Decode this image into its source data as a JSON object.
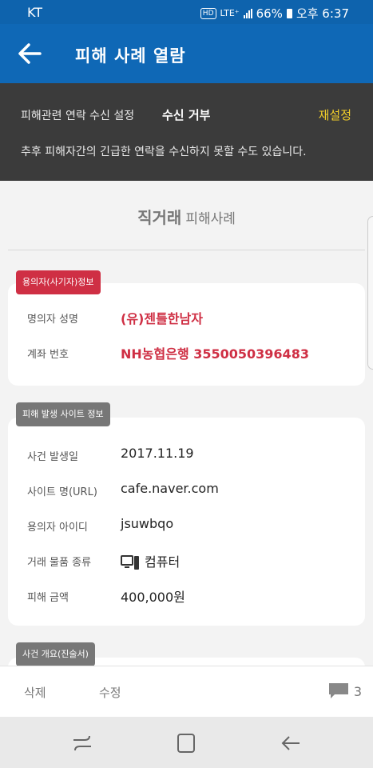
{
  "status_bar": {
    "carrier": "KT",
    "hd": "HD",
    "network": "LTE⁺",
    "battery": "66%",
    "time": "오후 6:37"
  },
  "app_bar": {
    "title": "피해 사례 열람",
    "back_icon": "arrow-left-icon"
  },
  "notice": {
    "label": "피해관련 연락 수신 설정",
    "value": "수신 거부",
    "reset": "재설정",
    "description": "추후 피해자간의 긴급한 연락을 수신하지 못할 수도 있습니다."
  },
  "page_header": {
    "title_bold": "직거래",
    "title_rest": "피해사례"
  },
  "suspect_section": {
    "tag": "용의자(사기자)정보",
    "rows": [
      {
        "key": "명의자 성명",
        "value": "(유)젠틀한남자"
      },
      {
        "key": "계좌 번호",
        "value": "NH농협은행 3550050396483"
      }
    ]
  },
  "site_section": {
    "tag": "피해 발생 사이트 정보",
    "rows": [
      {
        "key": "사건 발생일",
        "value": "2017.11.19"
      },
      {
        "key": "사이트 명(URL)",
        "value": "cafe.naver.com"
      },
      {
        "key": "용의자 아이디",
        "value": "jsuwbqo"
      },
      {
        "key": "거래 물품 종류",
        "value": "컴퓨터",
        "icon": "computer-icon"
      },
      {
        "key": "피해 금액",
        "value": "400,000원"
      }
    ]
  },
  "summary_section": {
    "tag": "사건 개요(진술서)"
  },
  "actions": {
    "delete": "삭제",
    "edit": "수정",
    "comment_count": "3",
    "comment_icon": "comment-icon"
  },
  "colors": {
    "app_bar": "#0f68b6",
    "notice_bg": "#3b3b3b",
    "highlight_red": "#cf2f44",
    "reset_yellow": "#f3cf2a"
  }
}
